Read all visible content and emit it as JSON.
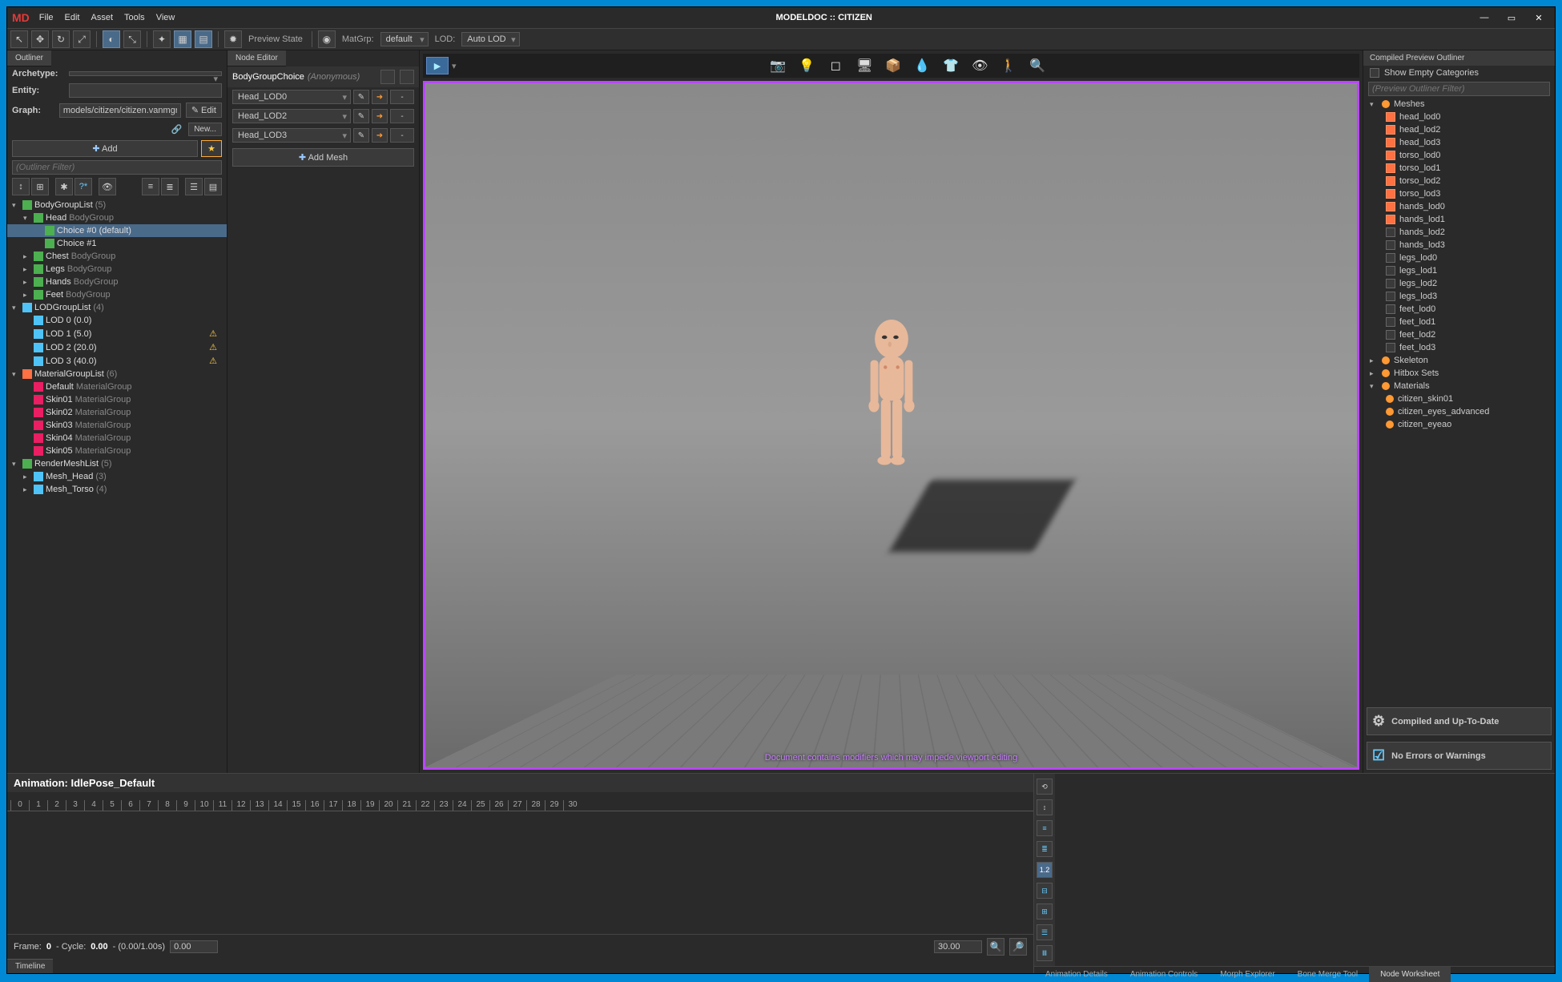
{
  "window": {
    "title": "MODELDOC :: CITIZEN",
    "logo": "MD"
  },
  "menu": [
    "File",
    "Edit",
    "Asset",
    "Tools",
    "View"
  ],
  "toolbar": {
    "preview_state_label": "Preview State",
    "matgrp_label": "MatGrp:",
    "matgrp_value": "default",
    "lod_label": "LOD:",
    "lod_value": "Auto LOD"
  },
  "outliner": {
    "tab": "Outliner",
    "archetype_label": "Archetype:",
    "archetype_value": "",
    "entity_label": "Entity:",
    "entity_value": "",
    "graph_label": "Graph:",
    "graph_value": "models/citizen/citizen.vanmgrph",
    "edit_btn": "Edit",
    "new_btn": "New...",
    "add_btn": "Add",
    "filter_placeholder": "(Outliner Filter)",
    "filter_glyph": "?*",
    "tree": [
      {
        "l": 0,
        "arrow": "▾",
        "icon": "ti-green",
        "name": "BodyGroupList",
        "type": " (5)"
      },
      {
        "l": 1,
        "arrow": "▾",
        "icon": "ti-green",
        "name": "Head",
        "type": " BodyGroup"
      },
      {
        "l": 2,
        "arrow": "",
        "icon": "ti-green",
        "name": "Choice #0 (default)",
        "type": "",
        "sel": true
      },
      {
        "l": 2,
        "arrow": "",
        "icon": "ti-green",
        "name": "Choice #1",
        "type": ""
      },
      {
        "l": 1,
        "arrow": "▸",
        "icon": "ti-green",
        "name": "Chest",
        "type": " BodyGroup"
      },
      {
        "l": 1,
        "arrow": "▸",
        "icon": "ti-green",
        "name": "Legs",
        "type": " BodyGroup"
      },
      {
        "l": 1,
        "arrow": "▸",
        "icon": "ti-green",
        "name": "Hands",
        "type": " BodyGroup"
      },
      {
        "l": 1,
        "arrow": "▸",
        "icon": "ti-green",
        "name": "Feet",
        "type": " BodyGroup"
      },
      {
        "l": 0,
        "arrow": "▾",
        "icon": "ti-blue",
        "name": "LODGroupList",
        "type": " (4)"
      },
      {
        "l": 1,
        "arrow": "",
        "icon": "ti-blue",
        "name": "LOD 0 (0.0)",
        "type": ""
      },
      {
        "l": 1,
        "arrow": "",
        "icon": "ti-blue",
        "name": "LOD 1 (5.0)",
        "type": "",
        "warn": true
      },
      {
        "l": 1,
        "arrow": "",
        "icon": "ti-blue",
        "name": "LOD 2 (20.0)",
        "type": "",
        "warn": true
      },
      {
        "l": 1,
        "arrow": "",
        "icon": "ti-blue",
        "name": "LOD 3 (40.0)",
        "type": "",
        "warn": true
      },
      {
        "l": 0,
        "arrow": "▾",
        "icon": "ti-orange",
        "name": "MaterialGroupList",
        "type": " (6)"
      },
      {
        "l": 1,
        "arrow": "",
        "icon": "ti-pink",
        "name": "Default",
        "type": " MaterialGroup"
      },
      {
        "l": 1,
        "arrow": "",
        "icon": "ti-pink",
        "name": "Skin01",
        "type": " MaterialGroup"
      },
      {
        "l": 1,
        "arrow": "",
        "icon": "ti-pink",
        "name": "Skin02",
        "type": " MaterialGroup"
      },
      {
        "l": 1,
        "arrow": "",
        "icon": "ti-pink",
        "name": "Skin03",
        "type": " MaterialGroup"
      },
      {
        "l": 1,
        "arrow": "",
        "icon": "ti-pink",
        "name": "Skin04",
        "type": " MaterialGroup"
      },
      {
        "l": 1,
        "arrow": "",
        "icon": "ti-pink",
        "name": "Skin05",
        "type": " MaterialGroup"
      },
      {
        "l": 0,
        "arrow": "▾",
        "icon": "ti-green",
        "name": "RenderMeshList",
        "type": " (5)"
      },
      {
        "l": 1,
        "arrow": "▸",
        "icon": "ti-blue",
        "name": "Mesh_Head",
        "type": " (3)"
      },
      {
        "l": 1,
        "arrow": "▸",
        "icon": "ti-blue",
        "name": "Mesh_Torso",
        "type": " (4)"
      }
    ]
  },
  "node_editor": {
    "tab": "Node Editor",
    "title": "BodyGroupChoice",
    "subtitle": "(Anonymous)",
    "rows": [
      "Head_LOD0",
      "Head_LOD2",
      "Head_LOD3"
    ],
    "add_mesh": "Add Mesh"
  },
  "viewport": {
    "warning": "Document contains modifiers which may impede viewport editing"
  },
  "right": {
    "header": "Compiled Preview Outliner",
    "show_empty": "Show Empty Categories",
    "filter_placeholder": "(Preview Outliner Filter)",
    "meshes_label": "Meshes",
    "meshes": [
      {
        "name": "head_lod0",
        "c": true
      },
      {
        "name": "head_lod2",
        "c": true
      },
      {
        "name": "head_lod3",
        "c": true
      },
      {
        "name": "torso_lod0",
        "c": true
      },
      {
        "name": "torso_lod1",
        "c": true
      },
      {
        "name": "torso_lod2",
        "c": true
      },
      {
        "name": "torso_lod3",
        "c": true
      },
      {
        "name": "hands_lod0",
        "c": true
      },
      {
        "name": "hands_lod1",
        "c": true
      },
      {
        "name": "hands_lod2",
        "c": false
      },
      {
        "name": "hands_lod3",
        "c": false
      },
      {
        "name": "legs_lod0",
        "c": false
      },
      {
        "name": "legs_lod1",
        "c": false
      },
      {
        "name": "legs_lod2",
        "c": false
      },
      {
        "name": "legs_lod3",
        "c": false
      },
      {
        "name": "feet_lod0",
        "c": false
      },
      {
        "name": "feet_lod1",
        "c": false
      },
      {
        "name": "feet_lod2",
        "c": false
      },
      {
        "name": "feet_lod3",
        "c": false
      }
    ],
    "skeleton": "Skeleton",
    "hitbox": "Hitbox Sets",
    "materials_label": "Materials",
    "materials": [
      "citizen_skin01",
      "citizen_eyes_advanced",
      "citizen_eyeao"
    ],
    "status1": "Compiled and Up-To-Date",
    "status2": "No Errors or Warnings"
  },
  "timeline": {
    "title": "Animation: IdlePose_Default",
    "ticks": 31,
    "frame_label": "Frame: ",
    "frame_val": "0",
    "cycle_label": " - Cycle: ",
    "cycle_val": "0.00",
    "cycle_extra": " - (0.00/1.00s)",
    "start": "0.00",
    "end": "30.00",
    "tab": "Timeline"
  },
  "inspector": {
    "speed": "1.2",
    "tabs": [
      "Animation Details",
      "Animation Controls",
      "Morph Explorer",
      "Bone Merge Tool",
      "Node Worksheet"
    ],
    "active_tab": 4
  }
}
